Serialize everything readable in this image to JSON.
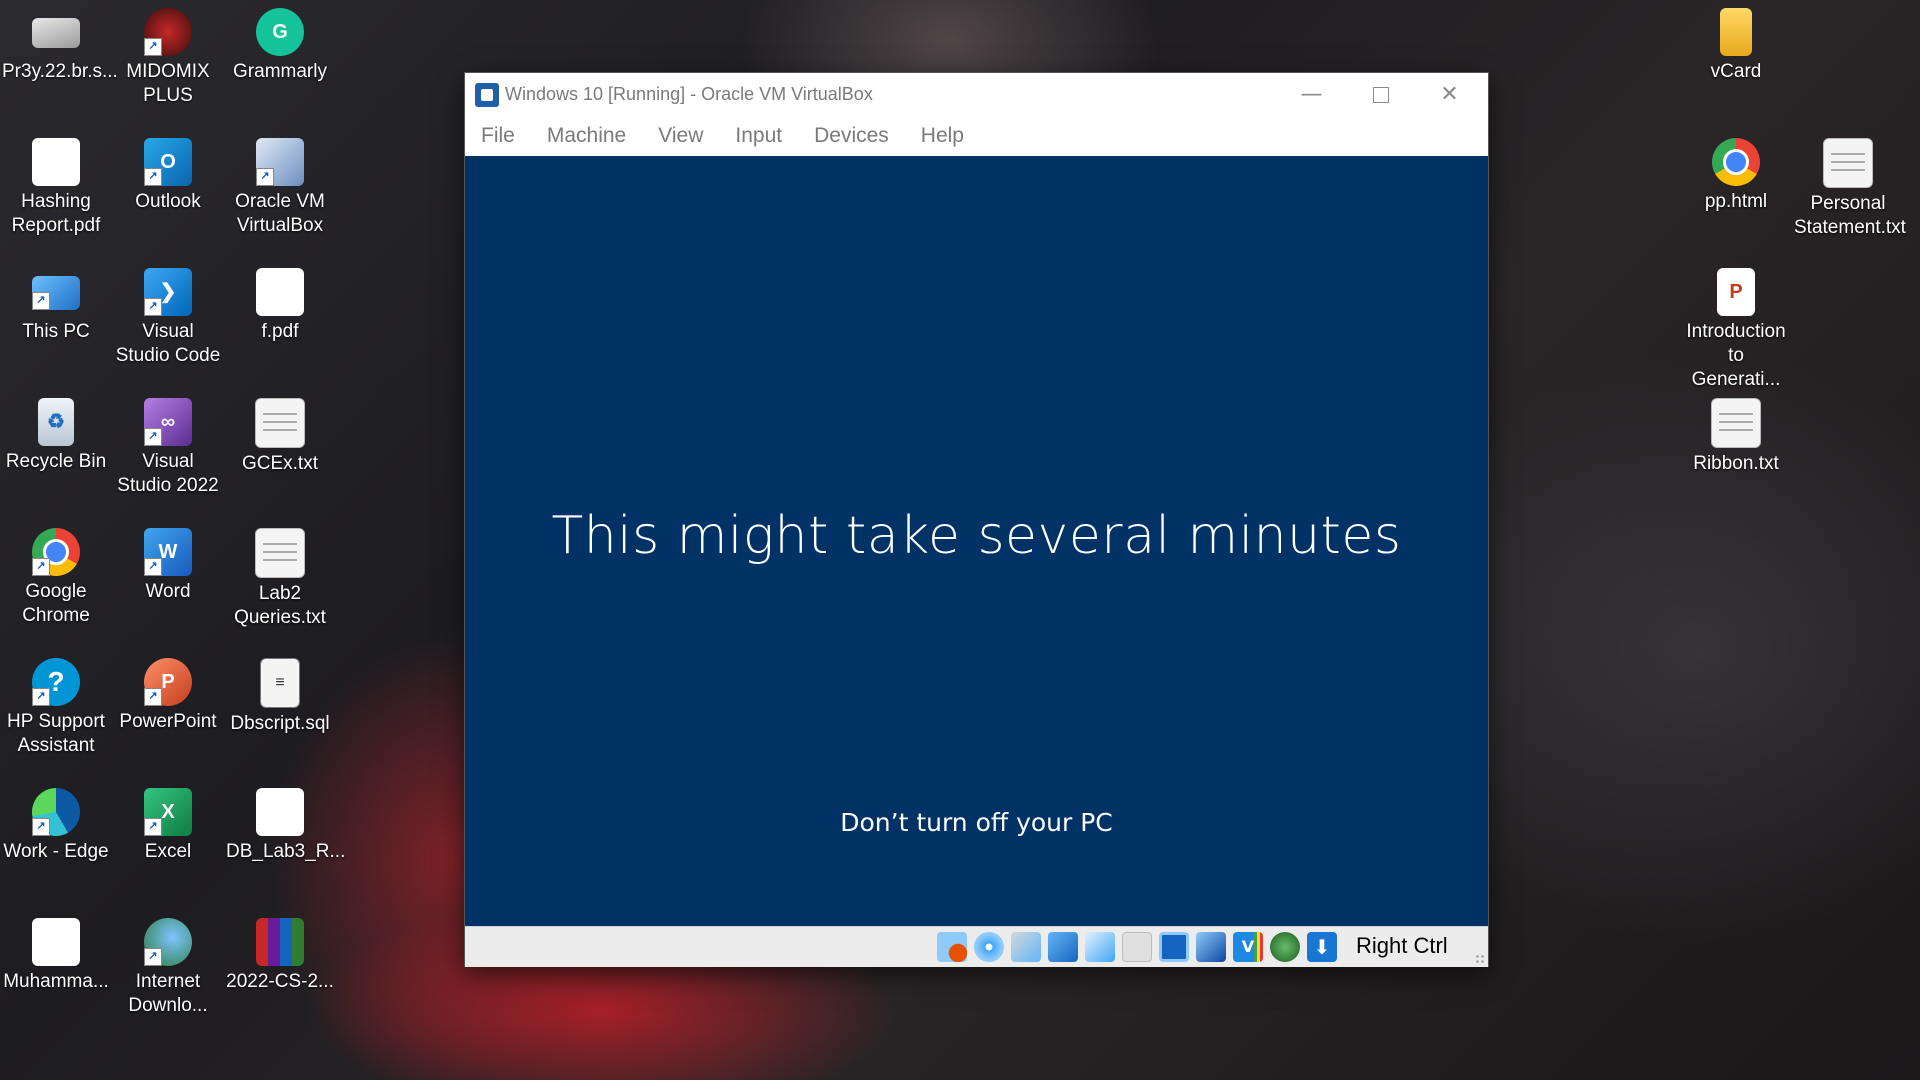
{
  "desktop": {
    "icons_left": [
      {
        "label": "Pr3y.22.br.s...",
        "icon": "image-file-icon"
      },
      {
        "label": "MIDOMIX PLUS",
        "icon": "midomix-app-icon"
      },
      {
        "label": "Grammarly",
        "icon": "grammarly-icon"
      },
      {
        "label": "Hashing Report.pdf",
        "icon": "pdf-file-icon"
      },
      {
        "label": "Outlook",
        "icon": "outlook-icon"
      },
      {
        "label": "Oracle VM VirtualBox",
        "icon": "virtualbox-icon"
      },
      {
        "label": "This PC",
        "icon": "this-pc-icon"
      },
      {
        "label": "Visual Studio Code",
        "icon": "vscode-icon"
      },
      {
        "label": "f.pdf",
        "icon": "pdf-file-icon"
      },
      {
        "label": "Recycle Bin",
        "icon": "recycle-bin-icon"
      },
      {
        "label": "Visual Studio 2022",
        "icon": "visual-studio-icon"
      },
      {
        "label": "GCEx.txt",
        "icon": "text-file-icon"
      },
      {
        "label": "Google Chrome",
        "icon": "chrome-icon"
      },
      {
        "label": "Word",
        "icon": "word-icon"
      },
      {
        "label": "Lab2 Queries.txt",
        "icon": "text-file-icon"
      },
      {
        "label": "HP Support Assistant",
        "icon": "hp-support-icon"
      },
      {
        "label": "PowerPoint",
        "icon": "powerpoint-icon"
      },
      {
        "label": "Dbscript.sql",
        "icon": "sql-file-icon"
      },
      {
        "label": "Work - Edge",
        "icon": "edge-icon"
      },
      {
        "label": "Excel",
        "icon": "excel-icon"
      },
      {
        "label": "DB_Lab3_R...",
        "icon": "pdf-file-icon"
      },
      {
        "label": "Muhamma...",
        "icon": "pdf-file-icon"
      },
      {
        "label": "Internet Downlo...",
        "icon": "idm-icon"
      },
      {
        "label": "2022-CS-2...",
        "icon": "winrar-icon"
      }
    ],
    "icons_right": [
      {
        "label": "vCard",
        "icon": "folder-icon"
      },
      {
        "label": "pp.html",
        "icon": "chrome-icon"
      },
      {
        "label": "Personal Statement.txt",
        "icon": "text-file-icon"
      },
      {
        "label": "Introduction to Generati...",
        "icon": "powerpoint-file-icon"
      },
      {
        "label": "Ribbon.txt",
        "icon": "text-file-icon"
      }
    ]
  },
  "vbox": {
    "title": "Windows 10 [Running] - Oracle VM VirtualBox",
    "menu": [
      "File",
      "Machine",
      "View",
      "Input",
      "Devices",
      "Help"
    ],
    "screen": {
      "heading": "This might take several minutes",
      "subtext": "Don’t turn off your PC",
      "background": "#013265"
    },
    "status_icons": [
      "hard-disk-icon",
      "optical-drive-icon",
      "audio-icon",
      "network-icon",
      "usb-icon",
      "shared-folders-icon",
      "display-icon",
      "video-capture-icon",
      "cpu-icon",
      "guest-additions-icon",
      "mouse-integration-icon"
    ],
    "host_key": "Right Ctrl"
  },
  "colors": {
    "vm_blue": "#013265",
    "menu_text": "#7a7a7a",
    "statusbar": "#ececec"
  }
}
